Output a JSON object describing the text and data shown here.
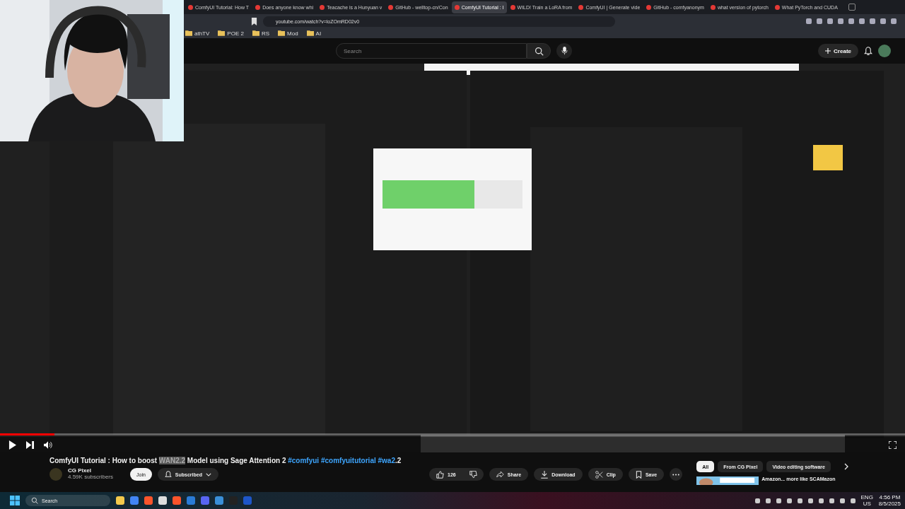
{
  "browser": {
    "tabs": [
      {
        "label": "ComfyUI Tutorial: How T",
        "selected": false
      },
      {
        "label": "Does anyone know whi",
        "selected": false
      },
      {
        "label": "Teacache is a Hunyuan v",
        "selected": false
      },
      {
        "label": "GitHub - welltop-cn/Con",
        "selected": false
      },
      {
        "label": "ComfyUI Tutorial : I",
        "selected": true
      },
      {
        "label": "WILD! Train a LoRA from",
        "selected": false
      },
      {
        "label": "ComfyUI | Generate vide",
        "selected": false
      },
      {
        "label": "GitHub - comfyanonym",
        "selected": false
      },
      {
        "label": "what version of pytorch",
        "selected": false
      },
      {
        "label": "What PyTorch and CUDA",
        "selected": false
      }
    ],
    "address": "youtube.com/watch?v=loZOmRD02v0",
    "bookmarks": [
      "athTV",
      "POE 2",
      "RS",
      "Mod",
      "AI"
    ]
  },
  "youtube": {
    "search_placeholder": "Search",
    "create": "Create"
  },
  "player": {
    "progress": {
      "level": 0.06
    }
  },
  "video": {
    "title_segments": [
      {
        "text": "ComfyUI Tutorial : How to boost ",
        "kind": "plain"
      },
      {
        "text": "WAN2.2",
        "kind": "highlighted"
      },
      {
        "text": " Model using Sage Attention 2 ",
        "kind": "plain"
      },
      {
        "text": "#comfyui",
        "kind": "hashtag"
      },
      {
        "text": " #comfyuitutorial",
        "kind": "hashtag"
      },
      {
        "text": " #wa2",
        "kind": "hashtag"
      },
      {
        "text": ".2",
        "kind": "plain"
      }
    ],
    "channel": "CG Pixel",
    "subscribers": "4.59K subscribers",
    "join": "Join",
    "subscribed": "Subscribed",
    "likes": "126",
    "actions": [
      "Share",
      "Download",
      "Clip",
      "Save"
    ]
  },
  "chips": [
    {
      "label": "All",
      "selected": true
    },
    {
      "label": "From CG Pixel",
      "selected": false
    },
    {
      "label": "Video editing software",
      "selected": false
    }
  ],
  "recommendation": {
    "title": "Amazon... more like SCAMazon"
  },
  "taskbar": {
    "search": "Search",
    "language": "ENG",
    "region": "US",
    "time": "4:56 PM",
    "date": "8/5/2025"
  }
}
